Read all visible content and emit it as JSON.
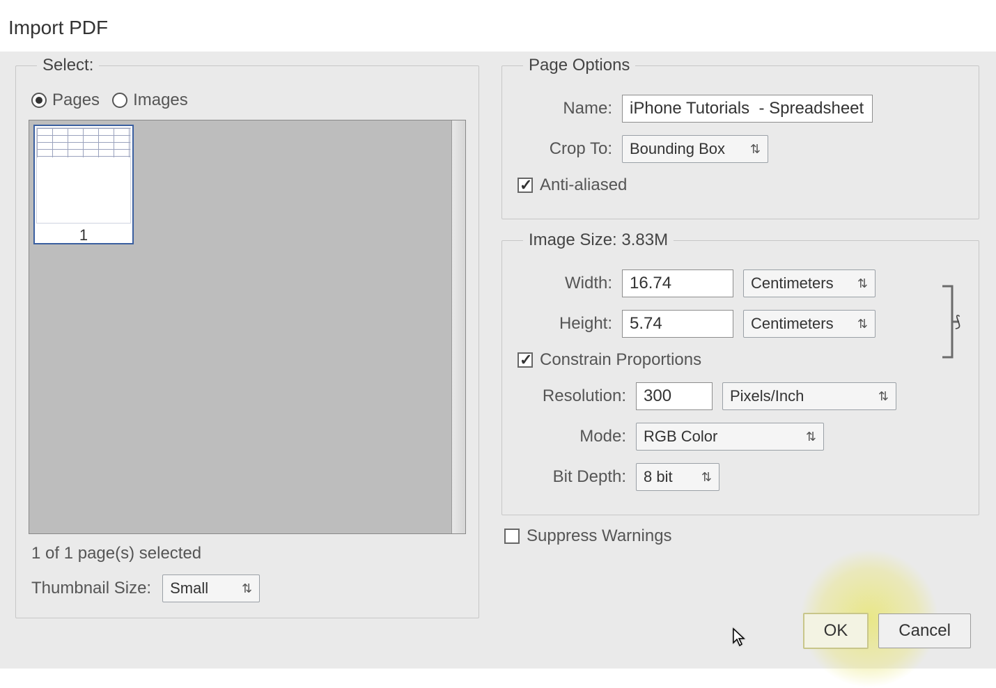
{
  "title": "Import PDF",
  "select": {
    "legend": "Select:",
    "pages_label": "Pages",
    "images_label": "Images",
    "selected_radio": "pages",
    "thumb_number": "1",
    "status": "1 of 1 page(s) selected",
    "thumb_size_label": "Thumbnail Size:",
    "thumb_size_value": "Small"
  },
  "page_options": {
    "legend": "Page Options",
    "name_label": "Name:",
    "name_value": "iPhone Tutorials  - Spreadsheet",
    "crop_label": "Crop To:",
    "crop_value": "Bounding Box",
    "antialiased_label": "Anti-aliased",
    "antialiased_checked": true
  },
  "image_size": {
    "legend": "Image Size: 3.83M",
    "width_label": "Width:",
    "width_value": "16.74",
    "width_unit": "Centimeters",
    "height_label": "Height:",
    "height_value": "5.74",
    "height_unit": "Centimeters",
    "constrain_label": "Constrain Proportions",
    "constrain_checked": true,
    "resolution_label": "Resolution:",
    "resolution_value": "300",
    "resolution_unit": "Pixels/Inch",
    "mode_label": "Mode:",
    "mode_value": "RGB Color",
    "bitdepth_label": "Bit Depth:",
    "bitdepth_value": "8 bit"
  },
  "suppress_label": "Suppress Warnings",
  "suppress_checked": false,
  "buttons": {
    "ok": "OK",
    "cancel": "Cancel"
  }
}
